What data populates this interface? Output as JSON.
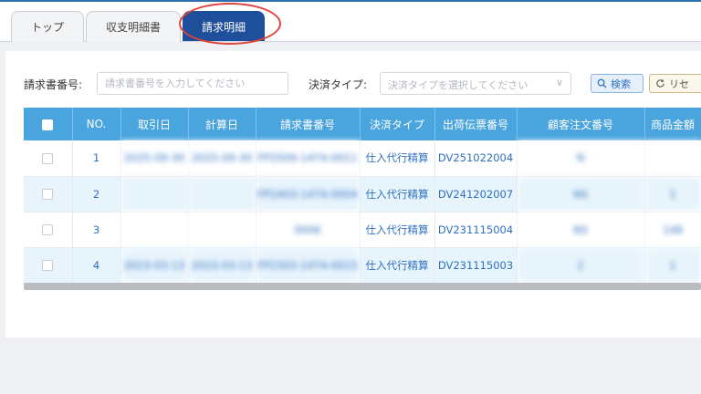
{
  "tabs": [
    {
      "label": "トップ"
    },
    {
      "label": "収支明細書"
    },
    {
      "label": "請求明細"
    }
  ],
  "filters": {
    "invoice_no_label": "請求書番号:",
    "invoice_no_placeholder": "請求書番号を入力してください",
    "payment_type_label": "決済タイプ:",
    "payment_type_placeholder": "決済タイプを選択してください",
    "search_label": "検索",
    "reset_label": "リセ"
  },
  "table": {
    "columns": [
      "NO.",
      "取引日",
      "計算日",
      "請求書番号",
      "決済タイプ",
      "出荷伝票番号",
      "顧客注文番号",
      "商品金額"
    ],
    "rows": [
      {
        "no": "1",
        "trade_date": "2025-09-30",
        "calc_date": "2025-09-30",
        "invoice": "FP2509-1474-0011",
        "type": "仕入代行精算",
        "slip": "DV251022004",
        "order": "N",
        "amount": ""
      },
      {
        "no": "2",
        "trade_date": "",
        "calc_date": "",
        "invoice": "FP2403-1474-0004",
        "type": "仕入代行精算",
        "slip": "DV241202007",
        "order": "NS",
        "amount": "1"
      },
      {
        "no": "3",
        "trade_date": "",
        "calc_date": "",
        "invoice": "0006",
        "type": "仕入代行精算",
        "slip": "DV231115004",
        "order": "NS",
        "amount": "148"
      },
      {
        "no": "4",
        "trade_date": "2023-03-13",
        "calc_date": "2023-03-13",
        "invoice": "FP2303-1474-0015",
        "type": "仕入代行精算",
        "slip": "DV231115003",
        "order": "2",
        "amount": "1"
      }
    ]
  },
  "colors": {
    "accent": "#1e4f9a",
    "header": "#4aa4de",
    "link": "#2f70c0",
    "ring": "#e0433a"
  },
  "icons": {
    "search": "search-icon",
    "reset": "refresh-icon",
    "dropdown": "chevron-down-icon"
  }
}
